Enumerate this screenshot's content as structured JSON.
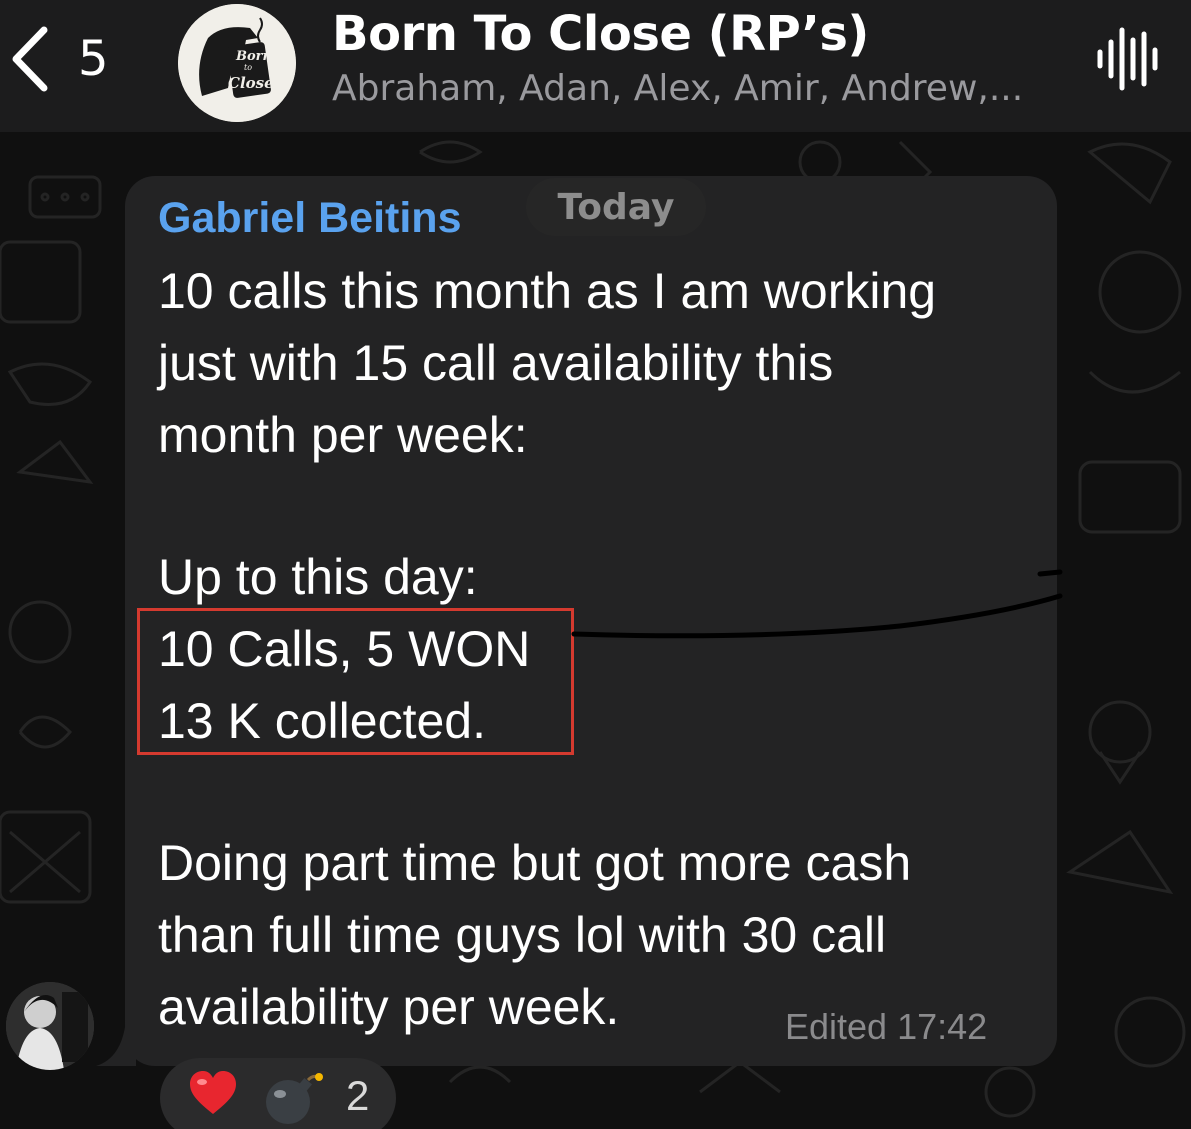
{
  "header": {
    "back_count": "5",
    "group_title": "Born To Close (RP’s)",
    "group_members": "Abraham, Adan, Alex, Amir, Andrew,...",
    "avatar_logo_text": "Born to Close"
  },
  "chat": {
    "date_label": "Today",
    "message": {
      "sender": "Gabriel Beitins",
      "lines": [
        "10 calls this month as I am working",
        "just with 15 call availability this",
        "month per week:",
        "Up to this day:",
        "10 Calls, 5 WON",
        "13 K collected.",
        "Doing part time but got more cash",
        "than full time guys lol with 30 call",
        "availability per week."
      ],
      "edited_label": "Edited",
      "time": "17:42"
    },
    "reactions": {
      "count": "2",
      "icons": [
        "heart-emoji",
        "bomb-emoji"
      ]
    }
  },
  "colors": {
    "sender_name": "#5aa2ee",
    "highlight_box": "#d43a2f",
    "bubble": "#232324"
  }
}
